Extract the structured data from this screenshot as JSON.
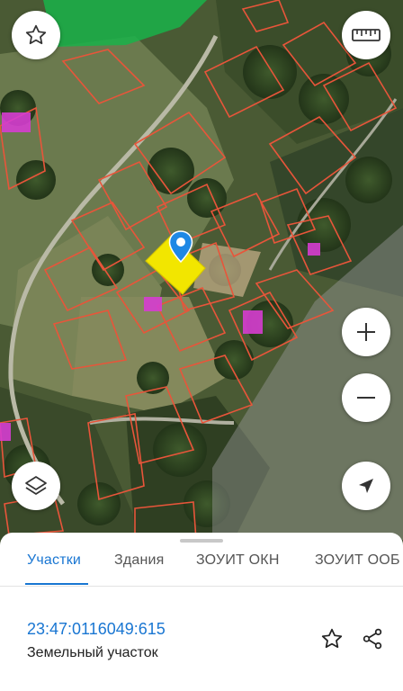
{
  "map": {
    "icons": {
      "favorite": "star-outline-icon",
      "ruler": "ruler-icon",
      "zoom_in": "plus-icon",
      "zoom_out": "minus-icon",
      "layers": "layers-icon",
      "locate": "navigation-arrow-icon",
      "marker": "location-pin-icon"
    },
    "colors": {
      "parcel_border": "#e8553a",
      "selected_parcel": "#f2e600",
      "marker": "#1e88e5",
      "building": "#d63dd0",
      "forest_zone": "#9a9a9a",
      "green_zone": "#19b34a"
    }
  },
  "sheet": {
    "tabs": [
      {
        "label": "Участки",
        "active": true
      },
      {
        "label": "Здания",
        "active": false
      },
      {
        "label": "ЗОУИТ ОКН",
        "active": false
      },
      {
        "label": "ЗОУИТ ООБ",
        "active": false
      }
    ],
    "parcel": {
      "cadastral_number": "23:47:0116049:615",
      "type": "Земельный участок"
    },
    "icons": {
      "favorite": "star-outline-icon",
      "share": "share-icon"
    },
    "accent_color": "#1976d2"
  }
}
